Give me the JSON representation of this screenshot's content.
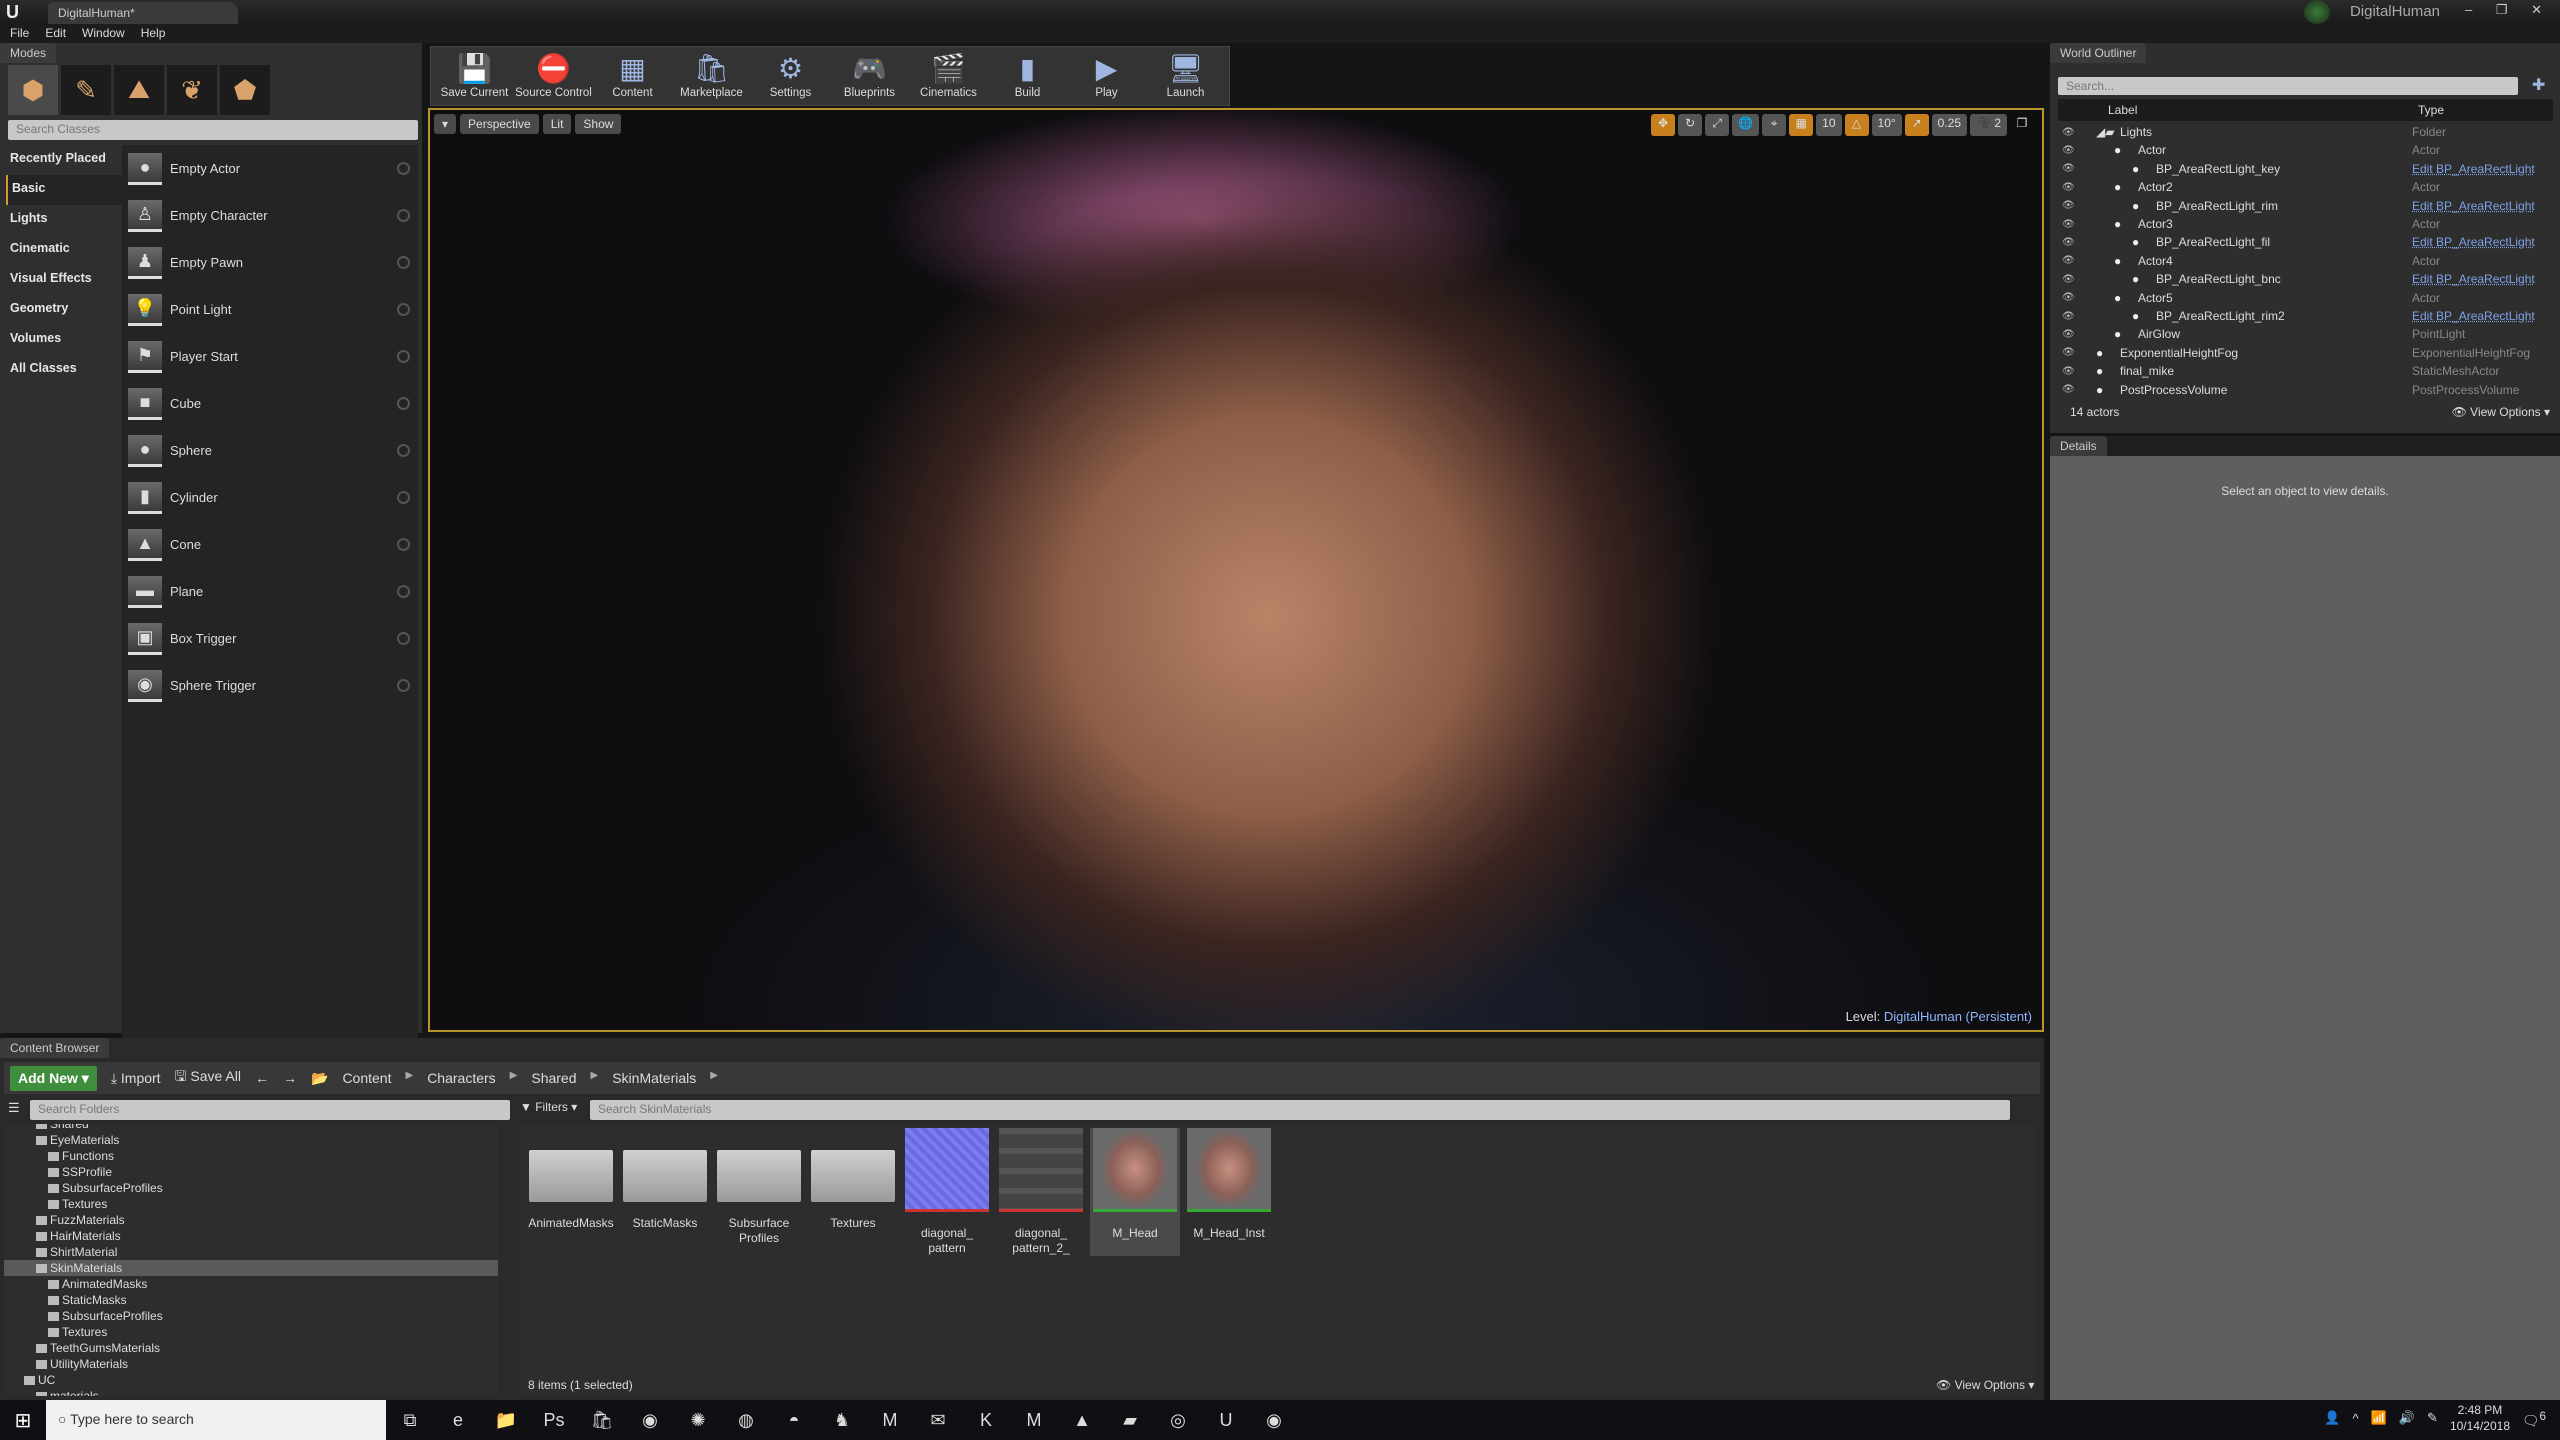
{
  "window": {
    "doc_tab": "DigitalHuman*",
    "project": "DigitalHuman",
    "controls": "– ❐ ✕"
  },
  "menu": [
    "File",
    "Edit",
    "Window",
    "Help"
  ],
  "modes": {
    "tab": "Modes",
    "search_placeholder": "Search Classes",
    "mode_icons": [
      "place-mode-icon",
      "paint-mode-icon",
      "landscape-mode-icon",
      "foliage-mode-icon",
      "geometry-mode-icon"
    ],
    "categories": [
      "Recently Placed",
      "Basic",
      "Lights",
      "Cinematic",
      "Visual Effects",
      "Geometry",
      "Volumes",
      "All Classes"
    ],
    "active_category": "Basic",
    "items": [
      "Empty Actor",
      "Empty Character",
      "Empty Pawn",
      "Point Light",
      "Player Start",
      "Cube",
      "Sphere",
      "Cylinder",
      "Cone",
      "Plane",
      "Box Trigger",
      "Sphere Trigger"
    ]
  },
  "toolbar": [
    {
      "label": "Save Current",
      "icon": "💾"
    },
    {
      "label": "Source Control",
      "icon": "⛔"
    },
    {
      "label": "Content",
      "icon": "▦"
    },
    {
      "label": "Marketplace",
      "icon": "🛍"
    },
    {
      "label": "Settings",
      "icon": "⚙"
    },
    {
      "label": "Blueprints",
      "icon": "🎮"
    },
    {
      "label": "Cinematics",
      "icon": "🎬"
    },
    {
      "label": "Build",
      "icon": "▮"
    },
    {
      "label": "Play",
      "icon": "▶"
    },
    {
      "label": "Launch",
      "icon": "🖥"
    }
  ],
  "viewport": {
    "view_mode": "Perspective",
    "lighting": "Lit",
    "show": "Show",
    "grid_snap": "10",
    "rot_snap": "10°",
    "scale_snap": "0.25",
    "camera_speed": "2",
    "level_label": "Level:",
    "level_name": "DigitalHuman (Persistent)"
  },
  "outliner": {
    "tab": "World Outliner",
    "search_placeholder": "Search...",
    "col_label": "Label",
    "col_type": "Type",
    "rows": [
      {
        "label": "Lights",
        "type": "Folder",
        "depth": 0,
        "link": false
      },
      {
        "label": "Actor",
        "type": "Actor",
        "depth": 1,
        "link": false
      },
      {
        "label": "BP_AreaRectLight_key",
        "type": "Edit BP_AreaRectLight",
        "depth": 2,
        "link": true
      },
      {
        "label": "Actor2",
        "type": "Actor",
        "depth": 1,
        "link": false
      },
      {
        "label": "BP_AreaRectLight_rim",
        "type": "Edit BP_AreaRectLight",
        "depth": 2,
        "link": true
      },
      {
        "label": "Actor3",
        "type": "Actor",
        "depth": 1,
        "link": false
      },
      {
        "label": "BP_AreaRectLight_fil",
        "type": "Edit BP_AreaRectLight",
        "depth": 2,
        "link": true
      },
      {
        "label": "Actor4",
        "type": "Actor",
        "depth": 1,
        "link": false
      },
      {
        "label": "BP_AreaRectLight_bnc",
        "type": "Edit BP_AreaRectLight",
        "depth": 2,
        "link": true
      },
      {
        "label": "Actor5",
        "type": "Actor",
        "depth": 1,
        "link": false
      },
      {
        "label": "BP_AreaRectLight_rim2",
        "type": "Edit BP_AreaRectLight",
        "depth": 2,
        "link": true
      },
      {
        "label": "AirGlow",
        "type": "PointLight",
        "depth": 1,
        "link": false
      },
      {
        "label": "ExponentialHeightFog",
        "type": "ExponentialHeightFog",
        "depth": 0,
        "link": false
      },
      {
        "label": "final_mike",
        "type": "StaticMeshActor",
        "depth": 0,
        "link": false
      },
      {
        "label": "PostProcessVolume",
        "type": "PostProcessVolume",
        "depth": 0,
        "link": false
      }
    ],
    "count": "14 actors",
    "view_options": "View Options"
  },
  "details": {
    "tab": "Details",
    "message": "Select an object to view details."
  },
  "content_browser": {
    "tab": "Content Browser",
    "add_new": "Add New",
    "import": "Import",
    "save_all": "Save All",
    "breadcrumb": [
      "Content",
      "Characters",
      "Shared",
      "SkinMaterials"
    ],
    "folder_search_placeholder": "Search Folders",
    "filters": "Filters",
    "asset_search_placeholder": "Search SkinMaterials",
    "tree": [
      {
        "label": "Shared",
        "depth": 1
      },
      {
        "label": "EyeMaterials",
        "depth": 1
      },
      {
        "label": "Functions",
        "depth": 2
      },
      {
        "label": "SSProfile",
        "depth": 2
      },
      {
        "label": "SubsurfaceProfiles",
        "depth": 2
      },
      {
        "label": "Textures",
        "depth": 2
      },
      {
        "label": "FuzzMaterials",
        "depth": 1
      },
      {
        "label": "HairMaterials",
        "depth": 1
      },
      {
        "label": "ShirtMaterial",
        "depth": 1
      },
      {
        "label": "SkinMaterials",
        "depth": 1,
        "selected": true
      },
      {
        "label": "AnimatedMasks",
        "depth": 2
      },
      {
        "label": "StaticMasks",
        "depth": 2
      },
      {
        "label": "SubsurfaceProfiles",
        "depth": 2
      },
      {
        "label": "Textures",
        "depth": 2
      },
      {
        "label": "TeethGumsMaterials",
        "depth": 1
      },
      {
        "label": "UtilityMaterials",
        "depth": 1
      },
      {
        "label": "UC",
        "depth": 0
      },
      {
        "label": "materials",
        "depth": 1
      }
    ],
    "assets": [
      {
        "label": "AnimatedMasks",
        "kind": "folder"
      },
      {
        "label": "StaticMasks",
        "kind": "folder"
      },
      {
        "label": "Subsurface Profiles",
        "kind": "folder"
      },
      {
        "label": "Textures",
        "kind": "folder"
      },
      {
        "label": "diagonal_ pattern",
        "kind": "texture-blue"
      },
      {
        "label": "diagonal_ pattern_2_",
        "kind": "texture-text"
      },
      {
        "label": "M_Head",
        "kind": "material",
        "selected": true
      },
      {
        "label": "M_Head_Inst",
        "kind": "material"
      }
    ],
    "status": "8 items (1 selected)",
    "view_options": "View Options"
  },
  "taskbar": {
    "search_placeholder": "Type here to search",
    "apps": [
      "task-view",
      "edge",
      "file-explorer",
      "photoshop",
      "store",
      "chrome",
      "app-blue",
      "app-red",
      "app-dark",
      "app-figure",
      "maya",
      "mail",
      "k-app",
      "m-app",
      "photos",
      "sticky",
      "app-m",
      "unreal",
      "app-orange"
    ],
    "time": "2:48 PM",
    "date": "10/14/2018",
    "notifications": "6"
  },
  "colors": {
    "accent": "#d69a2a",
    "add_new": "#3e8e3e",
    "link": "#7ea2e6",
    "snap_on": "#c8801e"
  }
}
